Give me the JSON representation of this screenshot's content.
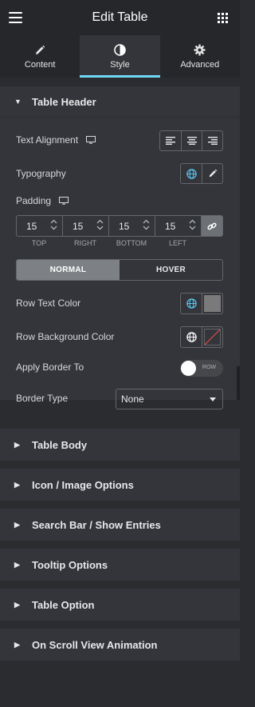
{
  "header": {
    "title": "Edit Table",
    "menu_icon": "hamburger-icon",
    "apps_icon": "grid-icon"
  },
  "tabs": [
    {
      "label": "Content",
      "icon": "pencil-icon",
      "active": false
    },
    {
      "label": "Style",
      "icon": "contrast-icon",
      "active": true
    },
    {
      "label": "Advanced",
      "icon": "gear-icon",
      "active": false
    }
  ],
  "section_open": {
    "title": "Table Header",
    "text_alignment": {
      "label": "Text Alignment",
      "options": [
        "left",
        "center",
        "right"
      ]
    },
    "typography": {
      "label": "Typography"
    },
    "padding": {
      "label": "Padding",
      "values": [
        "15",
        "15",
        "15",
        "15"
      ],
      "sides": [
        "TOP",
        "RIGHT",
        "BOTTOM",
        "LEFT"
      ]
    },
    "state_tabs": {
      "normal": "NORMAL",
      "hover": "HOVER",
      "active": "normal"
    },
    "row_text_color": {
      "label": "Row Text Color",
      "value": "#7a7a7a"
    },
    "row_bg_color": {
      "label": "Row Background Color"
    },
    "apply_border": {
      "label": "Apply Border To",
      "toggle_text": "ROW",
      "enabled": false
    },
    "border_type": {
      "label": "Border Type",
      "value": "None"
    }
  },
  "sections_closed": [
    "Table Body",
    "Icon / Image Options",
    "Search Bar / Show Entries",
    "Tooltip Options",
    "Table Option",
    "On Scroll View Animation"
  ],
  "colors": {
    "accent": "#71d7f7",
    "globe": "#5bc0eb"
  }
}
